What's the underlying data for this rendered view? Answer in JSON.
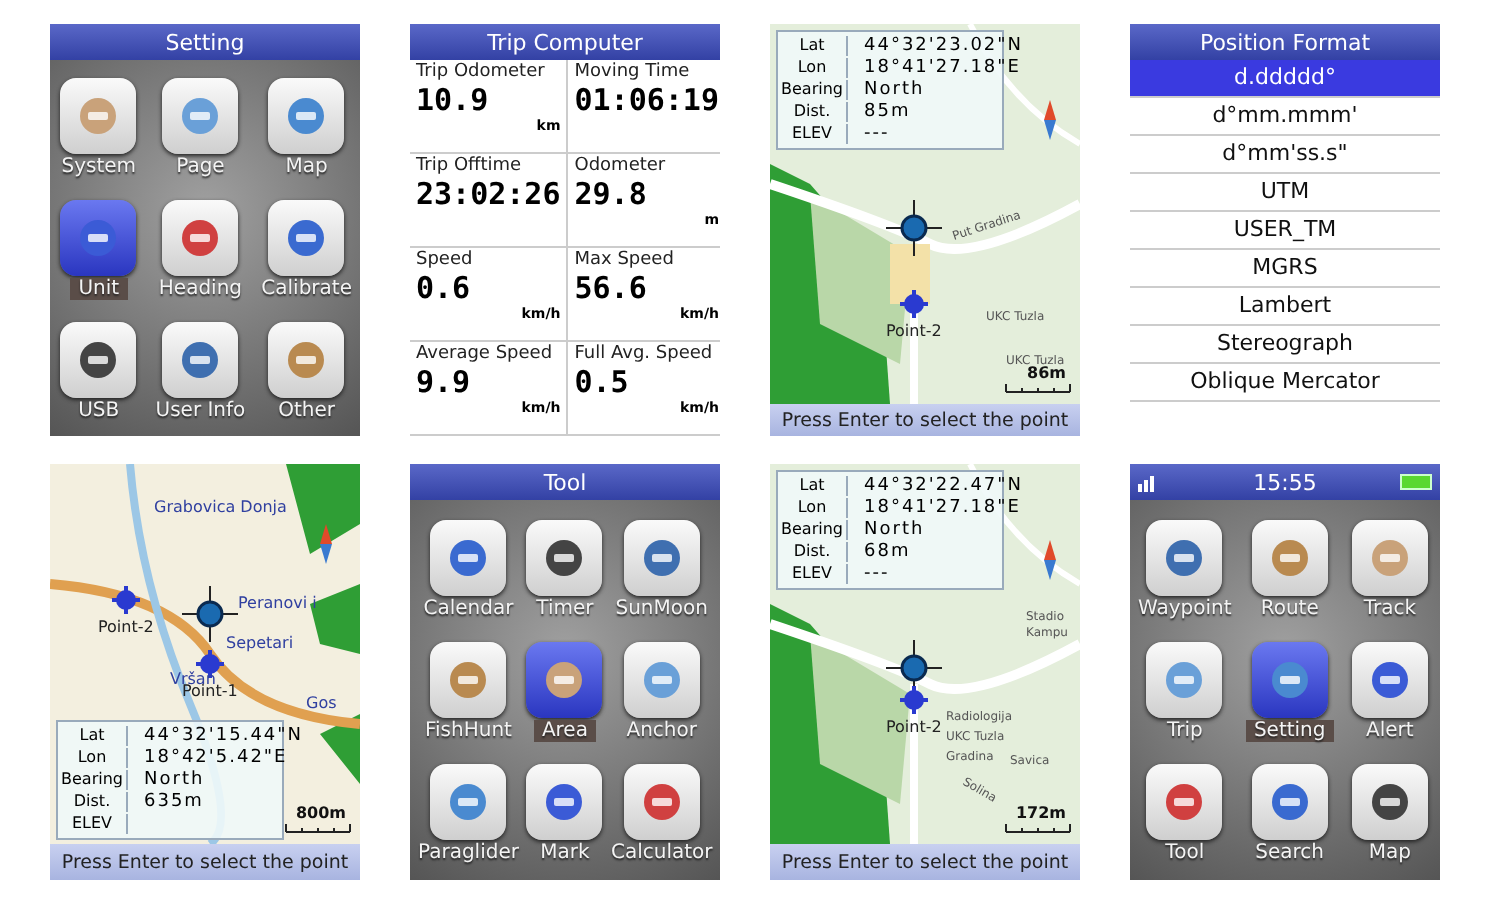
{
  "screens": [
    {
      "kind": "menu",
      "header": {
        "title": "Setting"
      },
      "items": [
        {
          "label": "System",
          "selected": false
        },
        {
          "label": "Page",
          "selected": false
        },
        {
          "label": "Map",
          "selected": false
        },
        {
          "label": "Unit",
          "selected": true
        },
        {
          "label": "Heading",
          "selected": false
        },
        {
          "label": "Calibrate",
          "selected": false
        },
        {
          "label": "USB",
          "selected": false
        },
        {
          "label": "User Info",
          "selected": false
        },
        {
          "label": "Other",
          "selected": false
        }
      ]
    },
    {
      "kind": "trip",
      "title": "Trip Computer",
      "cells": [
        {
          "label": "Trip Odometer",
          "value": "10.9",
          "unit": "km"
        },
        {
          "label": "Moving Time",
          "value": "01:06:19"
        },
        {
          "label": "Trip Offtime",
          "value": "23:02:26"
        },
        {
          "label": "Odometer",
          "value": "29.8",
          "unit": "m"
        },
        {
          "label": "Speed",
          "value": "0.6",
          "unit": "km/h"
        },
        {
          "label": "Max Speed",
          "value": "56.6",
          "unit": "km/h"
        },
        {
          "label": "Average Speed",
          "value": "9.9",
          "unit": "km/h"
        },
        {
          "label": "Full Avg. Speed",
          "value": "0.5",
          "unit": "km/h"
        }
      ]
    },
    {
      "kind": "map",
      "info": [
        {
          "label": "Lat",
          "value": "44°32'23.02\"N"
        },
        {
          "label": "Lon",
          "value": "18°41'27.18\"E"
        },
        {
          "label": "Bearing",
          "value": "North"
        },
        {
          "label": "Dist.",
          "value": "85m"
        },
        {
          "label": "ELEV",
          "value": "---"
        }
      ],
      "places": [
        "Put Gradina",
        "UKC Tuzla",
        "UKC Tuzla"
      ],
      "points": [
        "Point-2"
      ],
      "scale": "86m",
      "prompt": "Press Enter to select the point"
    },
    {
      "kind": "list",
      "title": "Position Format",
      "items": [
        {
          "label": "d.ddddd°",
          "selected": true
        },
        {
          "label": "d°mm.mmm'",
          "selected": false
        },
        {
          "label": "d°mm'ss.s\"",
          "selected": false
        },
        {
          "label": "UTM",
          "selected": false
        },
        {
          "label": "USER_TM",
          "selected": false
        },
        {
          "label": "MGRS",
          "selected": false
        },
        {
          "label": "Lambert",
          "selected": false
        },
        {
          "label": "Stereograph",
          "selected": false
        },
        {
          "label": "Oblique Mercator",
          "selected": false
        }
      ]
    },
    {
      "kind": "map",
      "info": [
        {
          "label": "Lat",
          "value": "44°32'15.44\"N"
        },
        {
          "label": "Lon",
          "value": "18°42'5.42\"E"
        },
        {
          "label": "Bearing",
          "value": "North"
        },
        {
          "label": "Dist.",
          "value": "635m"
        },
        {
          "label": "ELEV"
        }
      ],
      "places": [
        "Grabovica Donja",
        "Peranovi i",
        "Sepetari",
        "Gos",
        "Vršan"
      ],
      "points": [
        "Point-2",
        "Point-1"
      ],
      "scale": "800m",
      "prompt": "Press Enter to select the point"
    },
    {
      "kind": "menu",
      "header": {
        "title": "Tool"
      },
      "items": [
        {
          "label": "Calendar",
          "selected": false
        },
        {
          "label": "Timer",
          "selected": false
        },
        {
          "label": "SunMoon",
          "selected": false
        },
        {
          "label": "FishHunt",
          "selected": false
        },
        {
          "label": "Area",
          "selected": true
        },
        {
          "label": "Anchor",
          "selected": false
        },
        {
          "label": "Paraglider",
          "selected": false
        },
        {
          "label": "Mark",
          "selected": false
        },
        {
          "label": "Calculator",
          "selected": false
        }
      ]
    },
    {
      "kind": "map",
      "info": [
        {
          "label": "Lat",
          "value": "44°32'22.47\"N"
        },
        {
          "label": "Lon",
          "value": "18°41'27.18\"E"
        },
        {
          "label": "Bearing",
          "value": "North"
        },
        {
          "label": "Dist.",
          "value": "68m"
        },
        {
          "label": "ELEV",
          "value": "---"
        }
      ],
      "places": [
        "Stadio",
        "Kampu",
        "Radiologija",
        "UKC Tuzla",
        "Gradina",
        "Savica",
        "Solina"
      ],
      "points": [
        "Point-2"
      ],
      "scale": "172m",
      "prompt": "Press Enter to select the point"
    },
    {
      "kind": "menu",
      "header": {
        "time": "15:55"
      },
      "items": [
        {
          "label": "Waypoint",
          "selected": false
        },
        {
          "label": "Route",
          "selected": false
        },
        {
          "label": "Track",
          "selected": false
        },
        {
          "label": "Trip",
          "selected": false
        },
        {
          "label": "Setting",
          "selected": true
        },
        {
          "label": "Alert",
          "selected": false
        },
        {
          "label": "Tool",
          "selected": false
        },
        {
          "label": "Search",
          "selected": false
        },
        {
          "label": "Map",
          "selected": false
        }
      ]
    }
  ]
}
